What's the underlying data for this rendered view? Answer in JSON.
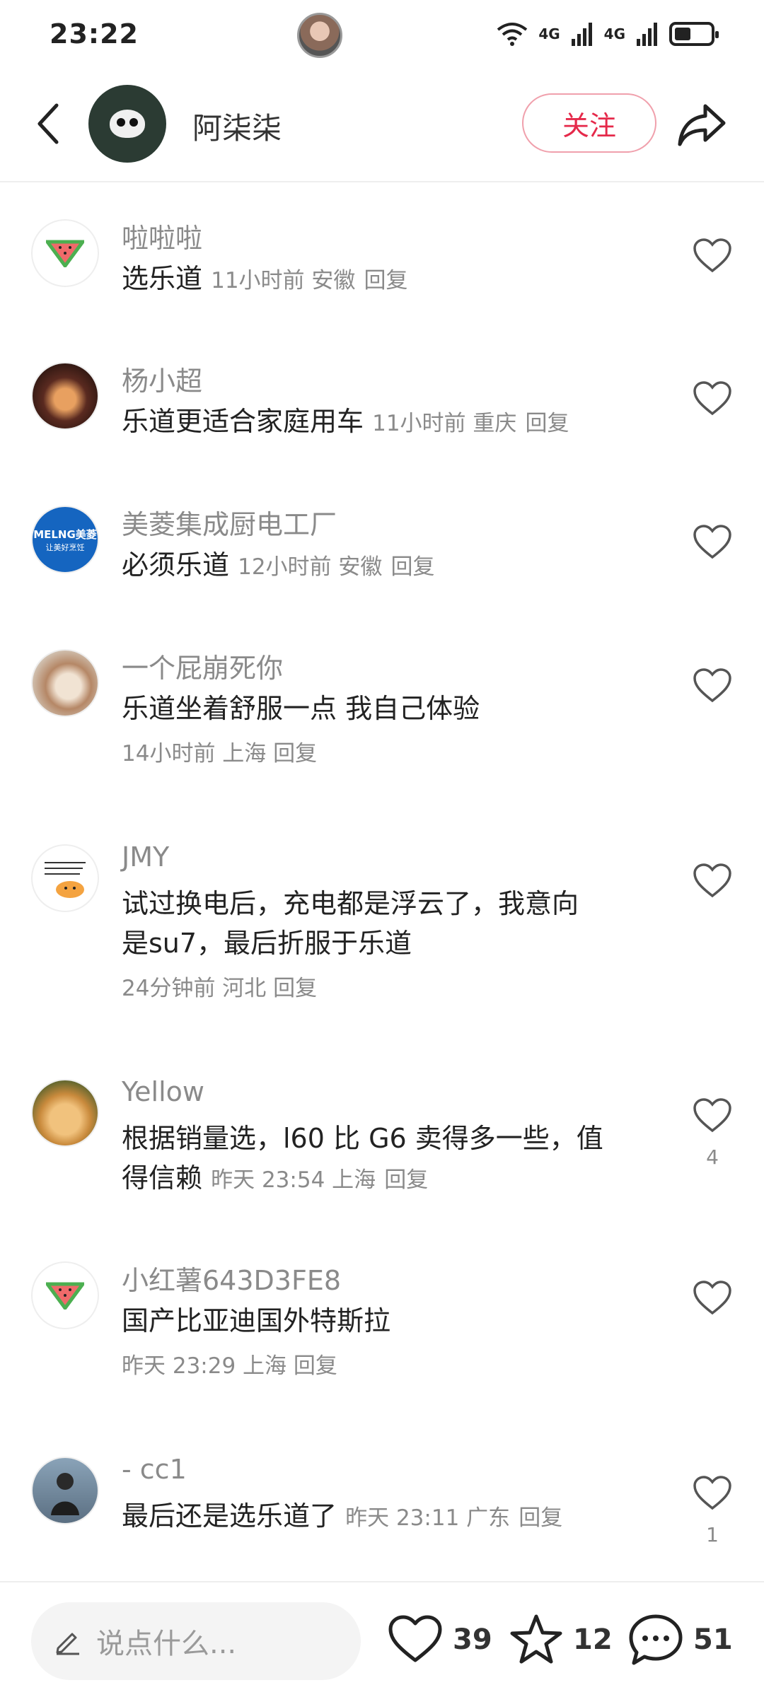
{
  "status_bar": {
    "time": "23:22",
    "network_1": "4G",
    "network_2": "4G"
  },
  "header": {
    "author_name": "阿柒柒",
    "follow_label": "关注"
  },
  "comments": [
    {
      "name": "啦啦啦",
      "text": "选乐道",
      "meta": "11小时前 安徽",
      "reply": "回复",
      "likes": ""
    },
    {
      "name": "杨小超",
      "text": "乐道更适合家庭用车",
      "meta": "11小时前 重庆",
      "reply": "回复",
      "likes": ""
    },
    {
      "name": "美菱集成厨电工厂",
      "text": "必须乐道",
      "meta": "12小时前 安徽",
      "reply": "回复",
      "likes": ""
    },
    {
      "name": "一个屁崩死你",
      "text": "乐道坐着舒服一点 我自己体验",
      "meta": "14小时前 上海",
      "reply": "回复",
      "likes": ""
    },
    {
      "name": "JMY",
      "text_line1": "试过换电后，充电都是浮云了，我意向",
      "text_line2": "是su7，最后折服于乐道",
      "meta": "24分钟前 河北",
      "reply": "回复",
      "likes": ""
    },
    {
      "name": "Yellow",
      "text_line1": "根据销量选，l60 比 G6 卖得多一些，值",
      "text_line2": "得信赖",
      "meta": "昨天 23:54 上海",
      "reply": "回复",
      "likes": "4"
    },
    {
      "name": "小红薯643D3FE8",
      "text": "国产比亚迪国外特斯拉",
      "meta": "昨天 23:29 上海",
      "reply": "回复",
      "likes": ""
    },
    {
      "name": "- cc1",
      "text": "最后还是选乐道了",
      "meta": "昨天 23:11 广东",
      "reply": "回复",
      "likes": "1"
    }
  ],
  "avatars": {
    "meling_line1": "MELNG美菱",
    "meling_line2": "让美好烹饪"
  },
  "bottom_bar": {
    "placeholder": "说点什么...",
    "like_count": "39",
    "star_count": "12",
    "comment_count": "51"
  }
}
